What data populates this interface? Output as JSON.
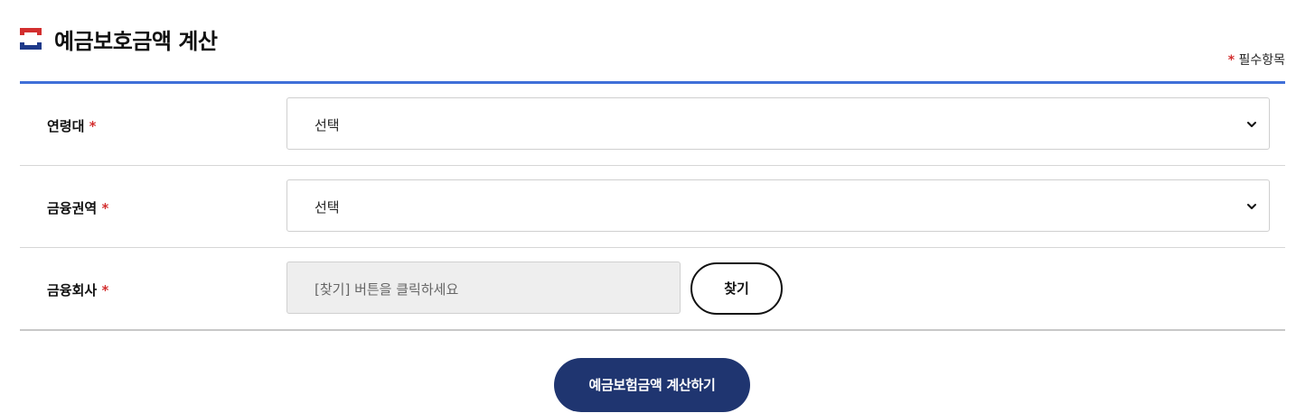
{
  "header": {
    "title": "예금보호금액 계산",
    "required_star": "*",
    "required_note": "필수항목"
  },
  "form": {
    "age_group": {
      "label": "연령대",
      "required_star": "*",
      "selected": "선택"
    },
    "financial_sector": {
      "label": "금융권역",
      "required_star": "*",
      "selected": "선택"
    },
    "financial_company": {
      "label": "금융회사",
      "required_star": "*",
      "placeholder": "[찾기] 버튼을 클릭하세요",
      "find_button": "찾기"
    }
  },
  "actions": {
    "calculate_button": "예금보험금액 계산하기"
  },
  "colors": {
    "accent_blue": "#3f6fd8",
    "navy_button": "#1f3570",
    "required_red": "#d32f2f",
    "icon_red": "#d32f2f",
    "icon_navy": "#1e3a8a"
  },
  "icons": {
    "title_icon": "bracket-square-icon",
    "select_arrow": "chevron-down-icon"
  }
}
